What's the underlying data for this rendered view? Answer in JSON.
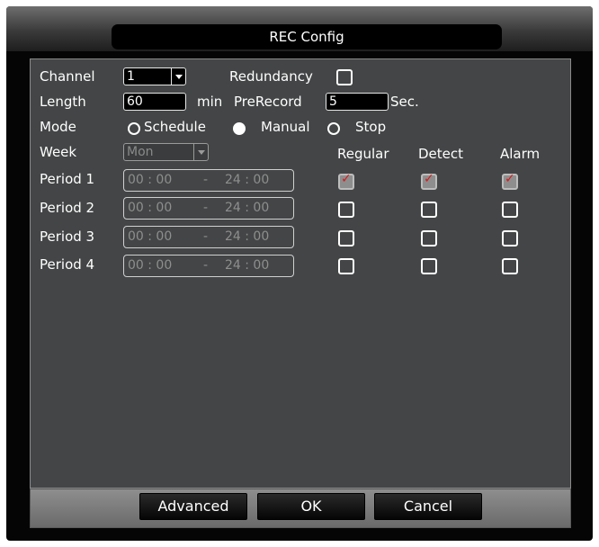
{
  "window": {
    "title": "REC Config"
  },
  "channel": {
    "label": "Channel",
    "value": "1"
  },
  "redundancy": {
    "label": "Redundancy",
    "checked": false
  },
  "length": {
    "label": "Length",
    "value": "60",
    "unit": "min"
  },
  "prerecord": {
    "label": "PreRecord",
    "value": "5",
    "unit": "Sec."
  },
  "mode": {
    "label": "Mode",
    "options": [
      "Schedule",
      "Manual",
      "Stop"
    ],
    "selected": "Manual"
  },
  "week": {
    "label": "Week",
    "value": "Mon"
  },
  "columns": [
    "Regular",
    "Detect",
    "Alarm"
  ],
  "periods": [
    {
      "label": "Period 1",
      "start": "00 : 00",
      "sep": "-",
      "end": "24 : 00",
      "regular": true,
      "detect": true,
      "alarm": true
    },
    {
      "label": "Period 2",
      "start": "00 : 00",
      "sep": "-",
      "end": "24 : 00",
      "regular": false,
      "detect": false,
      "alarm": false
    },
    {
      "label": "Period 3",
      "start": "00 : 00",
      "sep": "-",
      "end": "24 : 00",
      "regular": false,
      "detect": false,
      "alarm": false
    },
    {
      "label": "Period 4",
      "start": "00 : 00",
      "sep": "-",
      "end": "24 : 00",
      "regular": false,
      "detect": false,
      "alarm": false
    }
  ],
  "buttons": {
    "advanced": "Advanced",
    "ok": "OK",
    "cancel": "Cancel"
  },
  "colors": {
    "panel": "#434546",
    "text": "#ffffff",
    "disabled_text": "#8e8e8e",
    "check_mark": "#d21c1c"
  }
}
